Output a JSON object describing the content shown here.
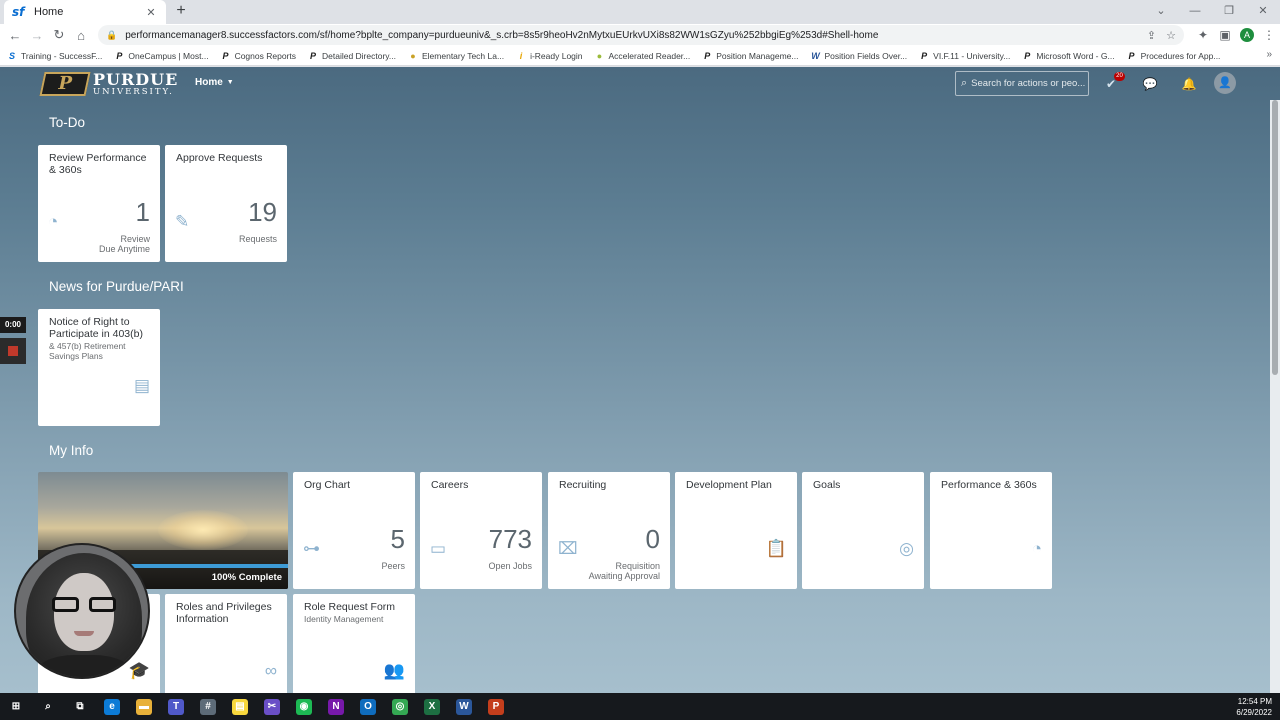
{
  "browser": {
    "tab_title": "Home",
    "tab_favicon": "sf",
    "new_tab": "+",
    "url": "performancemanager8.successfactors.com/sf/home?bplte_company=purdueuniv&_s.crb=8s5r9heoHv2nMytxuEUrkvUXi8s82WW1sGZyu%252bbgiEg%253d#Shell-home",
    "profile_initial": "A",
    "bookmarks": [
      {
        "label": "Training - SuccessF...",
        "icon": "sharepoint-icon",
        "color": "#0a6ed1"
      },
      {
        "label": "OneCampus | Most...",
        "icon": "purdue-icon",
        "color": "#1c1c1c"
      },
      {
        "label": "Cognos Reports",
        "icon": "purdue-icon",
        "color": "#1c1c1c"
      },
      {
        "label": "Detailed Directory...",
        "icon": "purdue-icon",
        "color": "#1c1c1c"
      },
      {
        "label": "Elementary Tech La...",
        "icon": "circle-icon",
        "color": "#c9a227"
      },
      {
        "label": "i-Ready Login",
        "icon": "iready-icon",
        "color": "#e6a400"
      },
      {
        "label": "Accelerated Reader...",
        "icon": "circle-icon",
        "color": "#9bbb3b"
      },
      {
        "label": "Position Manageme...",
        "icon": "purdue-icon",
        "color": "#1c1c1c"
      },
      {
        "label": "Position Fields Over...",
        "icon": "word-icon",
        "color": "#2b579a"
      },
      {
        "label": "VI.F.11 - University...",
        "icon": "purdue-icon",
        "color": "#1c1c1c"
      },
      {
        "label": "Microsoft Word - G...",
        "icon": "purdue-icon",
        "color": "#1c1c1c"
      },
      {
        "label": "Procedures for App...",
        "icon": "purdue-icon",
        "color": "#1c1c1c"
      }
    ]
  },
  "shell": {
    "logo_mark": "P",
    "logo_line1": "PURDUE",
    "logo_line2": "UNIVERSITY.",
    "home_menu": "Home",
    "search_placeholder": "Search for actions or peo...",
    "notification_badge": "20"
  },
  "recorder": {
    "time": "0:00"
  },
  "sections": {
    "todo": "To-Do",
    "news": "News for Purdue/PARI",
    "myinfo": "My Info"
  },
  "todo_tiles": [
    {
      "title": "Review Performance & 360s",
      "number": "1",
      "unit_line1": "Review",
      "unit_line2": "Due Anytime",
      "icon": "gauge-icon"
    },
    {
      "title": "Approve Requests",
      "number": "19",
      "unit_line1": "Requests",
      "unit_line2": "",
      "icon": "edit-document-icon"
    }
  ],
  "news_tile": {
    "title": "Notice of Right to Participate in 403(b)",
    "subtitle": "& 457(b) Retirement Savings Plans",
    "icon": "news-document-icon"
  },
  "profile_tile": {
    "completion_text": "100% Complete",
    "completion_value": 1.0,
    "accent": "#3d9bd6"
  },
  "myinfo_tiles": [
    {
      "title": "Org Chart",
      "number": "5",
      "unit_line1": "Peers",
      "unit_line2": "",
      "icon": "org-chart-icon"
    },
    {
      "title": "Careers",
      "number": "773",
      "unit_line1": "Open Jobs",
      "unit_line2": "",
      "icon": "briefcase-icon"
    },
    {
      "title": "Recruiting",
      "number": "0",
      "unit_line1": "Requisition",
      "unit_line2": "Awaiting Approval",
      "icon": "recruiting-icon"
    },
    {
      "title": "Development Plan",
      "number": "",
      "unit_line1": "",
      "unit_line2": "",
      "icon": "clipboard-icon"
    },
    {
      "title": "Goals",
      "number": "",
      "unit_line1": "",
      "unit_line2": "",
      "icon": "target-icon"
    },
    {
      "title": "Performance & 360s",
      "number": "",
      "unit_line1": "",
      "unit_line2": "",
      "icon": "gauge-icon"
    }
  ],
  "row3_tiles": [
    {
      "title": "",
      "subtitle": "",
      "icon": "graduation-cap-icon"
    },
    {
      "title": "Roles and Privileges Information",
      "subtitle": "",
      "icon": "glasses-icon"
    },
    {
      "title": "Role Request Form",
      "subtitle": "Identity Management",
      "icon": "group-icon"
    }
  ],
  "taskbar": {
    "apps": [
      {
        "name": "start-button",
        "glyph": "⊞",
        "bg": "transparent"
      },
      {
        "name": "search-icon",
        "glyph": "⌕",
        "bg": "transparent"
      },
      {
        "name": "task-view-icon",
        "glyph": "⧉",
        "bg": "transparent"
      },
      {
        "name": "edge-icon",
        "glyph": "e",
        "bg": "#0c7bd6"
      },
      {
        "name": "file-explorer-icon",
        "glyph": "▬",
        "bg": "#e8b13a"
      },
      {
        "name": "teams-icon",
        "glyph": "T",
        "bg": "#5059c9"
      },
      {
        "name": "calculator-icon",
        "glyph": "#",
        "bg": "#5d6b78"
      },
      {
        "name": "sticky-notes-icon",
        "glyph": "▤",
        "bg": "#f7d73d"
      },
      {
        "name": "snipping-tool-icon",
        "glyph": "✂",
        "bg": "#6a4fc7"
      },
      {
        "name": "spotify-icon",
        "glyph": "◉",
        "bg": "#1db954"
      },
      {
        "name": "onenote-icon",
        "glyph": "N",
        "bg": "#7719aa"
      },
      {
        "name": "outlook-icon",
        "glyph": "O",
        "bg": "#0f6cbd"
      },
      {
        "name": "chrome-icon",
        "glyph": "◎",
        "bg": "#34a853"
      },
      {
        "name": "excel-icon",
        "glyph": "X",
        "bg": "#1d6f42"
      },
      {
        "name": "word-icon",
        "glyph": "W",
        "bg": "#2b579a"
      },
      {
        "name": "powerpoint-icon",
        "glyph": "P",
        "bg": "#c43e1c"
      }
    ],
    "time": "12:54 PM",
    "date": "6/29/2022"
  }
}
